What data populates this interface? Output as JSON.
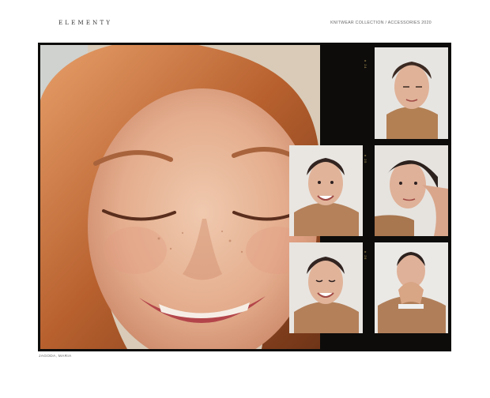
{
  "header": {
    "brand": "ELEMENTY",
    "collection": "KNITWEAR COLLECTION / ACCESSORIES 2020"
  },
  "caption": "JAGODA, MARIA",
  "icons": {
    "hero": "smiling-woman-photo",
    "contact_sheet": "film-contact-sheet"
  }
}
